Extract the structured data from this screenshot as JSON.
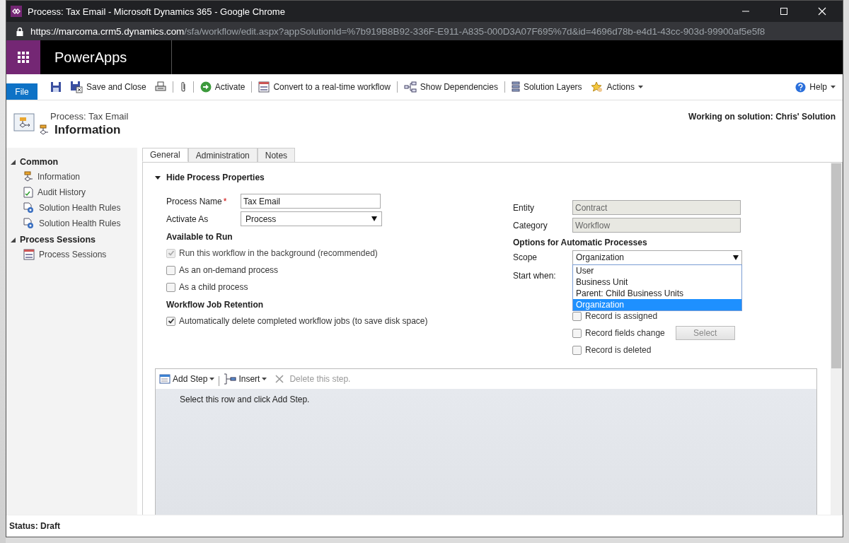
{
  "browser": {
    "title": "Process: Tax Email - Microsoft Dynamics 365 - Google Chrome",
    "url_host": "https://marcoma.crm5.dynamics.com",
    "url_path": "/sfa/workflow/edit.aspx?appSolutionId=%7b919B8B92-336F-E911-A835-000D3A07F695%7d&id=4696d78b-e4d1-43cc-903d-99900af5e5f8"
  },
  "app_bar": {
    "app_name": "PowerApps"
  },
  "toolbar": {
    "file": "File",
    "help": "Help",
    "items": [
      {
        "kind": "save"
      },
      {
        "kind": "save-close",
        "label": "Save and Close"
      },
      {
        "kind": "print"
      },
      {
        "kind": "separator"
      },
      {
        "kind": "attach"
      },
      {
        "kind": "separator"
      },
      {
        "kind": "activate",
        "label": "Activate"
      },
      {
        "kind": "separator"
      },
      {
        "kind": "convert",
        "label": "Convert to a real-time workflow"
      },
      {
        "kind": "separator"
      },
      {
        "kind": "dependencies",
        "label": "Show Dependencies"
      },
      {
        "kind": "separator"
      },
      {
        "kind": "layers",
        "label": "Solution Layers"
      },
      {
        "kind": "actions",
        "label": "Actions",
        "menu": true
      }
    ]
  },
  "header": {
    "subtitle": "Process: Tax Email",
    "title": "Information",
    "solution": "Working on solution: Chris' Solution"
  },
  "nav": [
    {
      "label": "Common",
      "expanded": true,
      "children": [
        {
          "label": "Information",
          "kind": "process"
        },
        {
          "label": "Audit History",
          "kind": "audit"
        },
        {
          "label": "Solution Health Rules",
          "kind": "rules"
        },
        {
          "label": "Solution Health Rules",
          "kind": "rules"
        }
      ]
    },
    {
      "label": "Process Sessions",
      "expanded": true,
      "children": [
        {
          "label": "Process Sessions",
          "kind": "sessions"
        }
      ]
    }
  ],
  "tabs": [
    {
      "label": "General",
      "selected": true
    },
    {
      "label": "Administration",
      "selected": false
    },
    {
      "label": "Notes",
      "selected": false
    }
  ],
  "section": {
    "title": "Hide Process Properties",
    "expanded": true
  },
  "process_name": {
    "label": "Process Name",
    "required_mark": "*",
    "value": "Tax Email"
  },
  "activate_as": {
    "label": "Activate As",
    "value": "Process"
  },
  "available_to_run": {
    "title": "Available to Run",
    "options": [
      {
        "label": "Run this workflow in the background (recommended)",
        "checked": true,
        "disabled": true
      },
      {
        "label": "As an on-demand process",
        "checked": false,
        "disabled": false
      },
      {
        "label": "As a child process",
        "checked": false,
        "disabled": false
      }
    ]
  },
  "job_retention": {
    "title": "Workflow Job Retention",
    "options": [
      {
        "label": "Automatically delete completed workflow jobs (to save disk space)",
        "checked": true,
        "disabled": false
      }
    ]
  },
  "entity": {
    "label": "Entity",
    "value": "Contract"
  },
  "category": {
    "label": "Category",
    "value": "Workflow"
  },
  "automatic": {
    "title": "Options for Automatic Processes",
    "scope": {
      "label": "Scope",
      "value": "Organization",
      "open": true,
      "options": [
        {
          "label": "User",
          "selected": false
        },
        {
          "label": "Business Unit",
          "selected": false
        },
        {
          "label": "Parent: Child Business Units",
          "selected": false
        },
        {
          "label": "Organization",
          "selected": true
        }
      ]
    },
    "start_when": {
      "label": "Start when:",
      "options": [
        {
          "label": "Record is assigned",
          "checked": false
        },
        {
          "label": "Record fields change",
          "checked": false,
          "button": "Select"
        },
        {
          "label": "Record is deleted",
          "checked": false
        }
      ]
    }
  },
  "steps": {
    "add_step": "Add Step",
    "insert": "Insert",
    "delete": "Delete this step.",
    "delete_disabled": true,
    "hint": "Select this row and click Add Step."
  },
  "status_bar": {
    "text": "Status: Draft"
  }
}
